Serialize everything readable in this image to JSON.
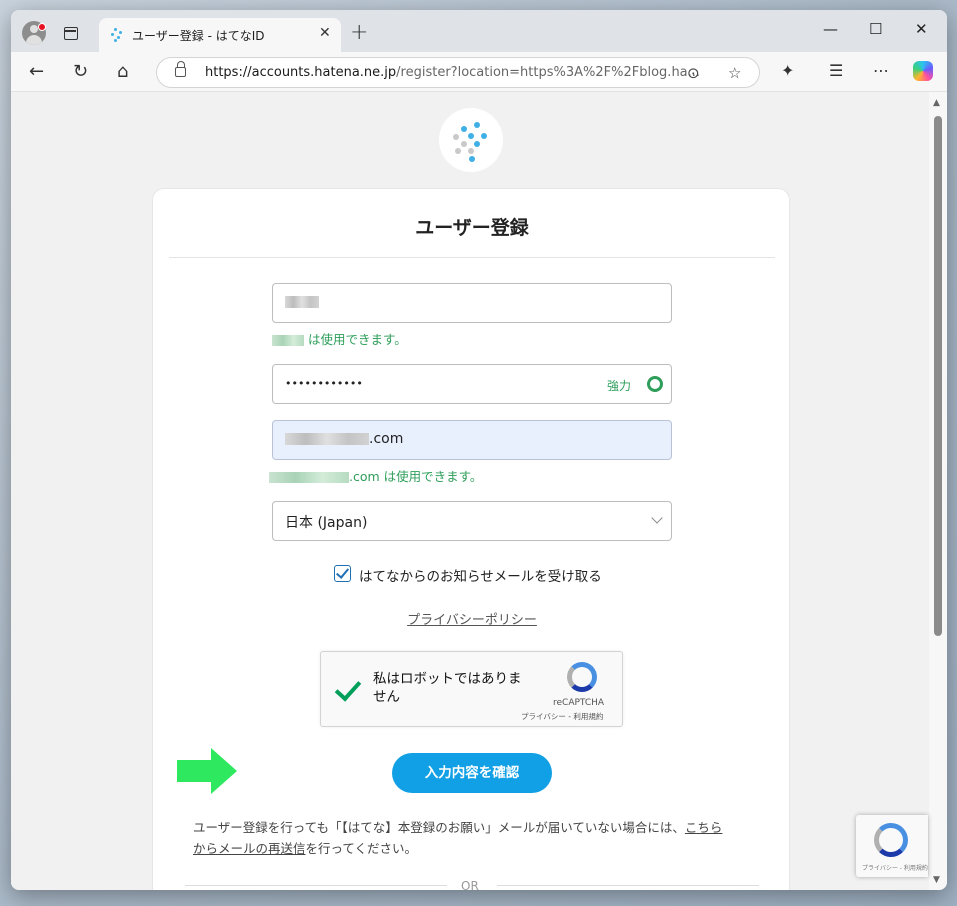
{
  "browser": {
    "tab_title": "ユーザー登録 - はてなID",
    "tab_close": "✕",
    "new_tab": "+",
    "url_domain": "https://accounts.hatena.ne.jp",
    "url_path": "/register?location=https%3A%2F%2Fblog.ha...",
    "window_buttons": {
      "minimize": "—",
      "maximize": "☐",
      "close": "✕"
    }
  },
  "form": {
    "title": "ユーザー登録",
    "username_ok": "は使用できます。",
    "password_masked": "••••••••••••",
    "password_strength": "強力",
    "email_suffix": ".com",
    "email_ok": ".com は使用できます。",
    "country": "日本 (Japan)",
    "newsletter_label": "はてなからのお知らせメールを受け取る",
    "privacy_link": "プライバシーポリシー",
    "recaptcha_label": "私はロボットではありません",
    "recaptcha_brand": "reCAPTCHA",
    "recaptcha_terms": "プライバシー - 利用規約",
    "confirm_button": "入力内容を確認",
    "note_text": "ユーザー登録を行っても「【はてな】本登録のお願い」メールが届いていない場合には、",
    "note_link1": "こちら",
    "note_link2": "からメールの再送信",
    "note_tail": "を行ってください。",
    "or_text": "OR"
  },
  "recaptcha_badge": {
    "text": "プライバシー - 利用規約"
  },
  "colors": {
    "accent": "#11a0e5",
    "success": "#2e9e5a",
    "arrow": "#2ee85f"
  }
}
